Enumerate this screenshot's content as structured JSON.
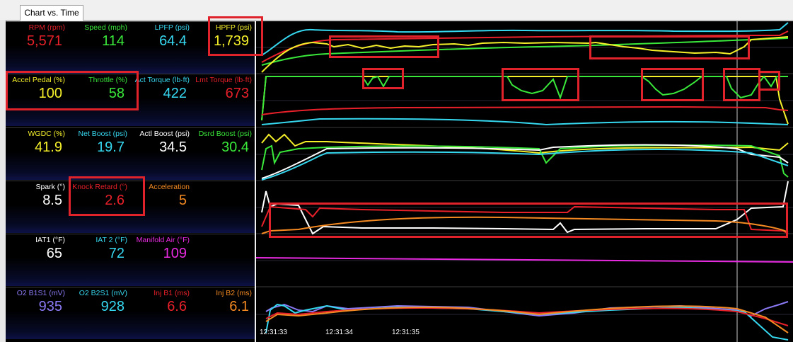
{
  "tab": {
    "label": "Chart vs. Time"
  },
  "gauges": [
    [
      {
        "label": "RPM (rpm)",
        "value": "5,571",
        "color": "#e8202a"
      },
      {
        "label": "Speed (mph)",
        "value": "114",
        "color": "#39e83a"
      },
      {
        "label": "LPFP (psi)",
        "value": "64.4",
        "color": "#36d8f0"
      },
      {
        "label": "HPFP (psi)",
        "value": "1,739",
        "color": "#f5f02a"
      }
    ],
    [
      {
        "label": "Accel Pedal (%)",
        "value": "100",
        "color": "#f5f02a"
      },
      {
        "label": "Throttle (%)",
        "value": "58",
        "color": "#39e83a"
      },
      {
        "label": "Act Torque (lb·ft)",
        "value": "422",
        "color": "#36d8f0"
      },
      {
        "label": "Lmt Torque (lb·ft)",
        "value": "673",
        "color": "#e8202a"
      }
    ],
    [
      {
        "label": "WGDC (%)",
        "value": "41.9",
        "color": "#f5f02a"
      },
      {
        "label": "Net Boost (psi)",
        "value": "19.7",
        "color": "#36d8f0"
      },
      {
        "label": "Actl Boost (psi)",
        "value": "34.5",
        "color": "#ffffff"
      },
      {
        "label": "Dsrd Boost (psi)",
        "value": "30.4",
        "color": "#39e83a"
      }
    ],
    [
      {
        "label": "Spark (°)",
        "value": "8.5",
        "color": "#ffffff"
      },
      {
        "label": "Knock Retard (°)",
        "value": "2.6",
        "color": "#e8202a"
      },
      {
        "label": "Acceleration",
        "value": "5",
        "color": "#f58a22"
      }
    ],
    [
      {
        "label": "IAT1 (°F)",
        "value": "65",
        "color": "#ffffff"
      },
      {
        "label": "IAT 2 (°F)",
        "value": "72",
        "color": "#36d8f0"
      },
      {
        "label": "Manifold Air (°F)",
        "value": "109",
        "color": "#e82ae0"
      }
    ],
    [
      {
        "label": "O2 B1S1 (mV)",
        "value": "935",
        "color": "#8a7af5"
      },
      {
        "label": "O2 B2S1 (mV)",
        "value": "928",
        "color": "#36d8f0"
      },
      {
        "label": "Inj B1 (ms)",
        "value": "6.6",
        "color": "#e8202a"
      },
      {
        "label": "Inj B2 (ms)",
        "value": "6.1",
        "color": "#f58a22"
      }
    ]
  ],
  "time_axis": [
    "12:31:33",
    "12:31:34",
    "12:31:35"
  ],
  "colors": {
    "highlight": "#e0222b",
    "panel_bg": "#000000"
  }
}
